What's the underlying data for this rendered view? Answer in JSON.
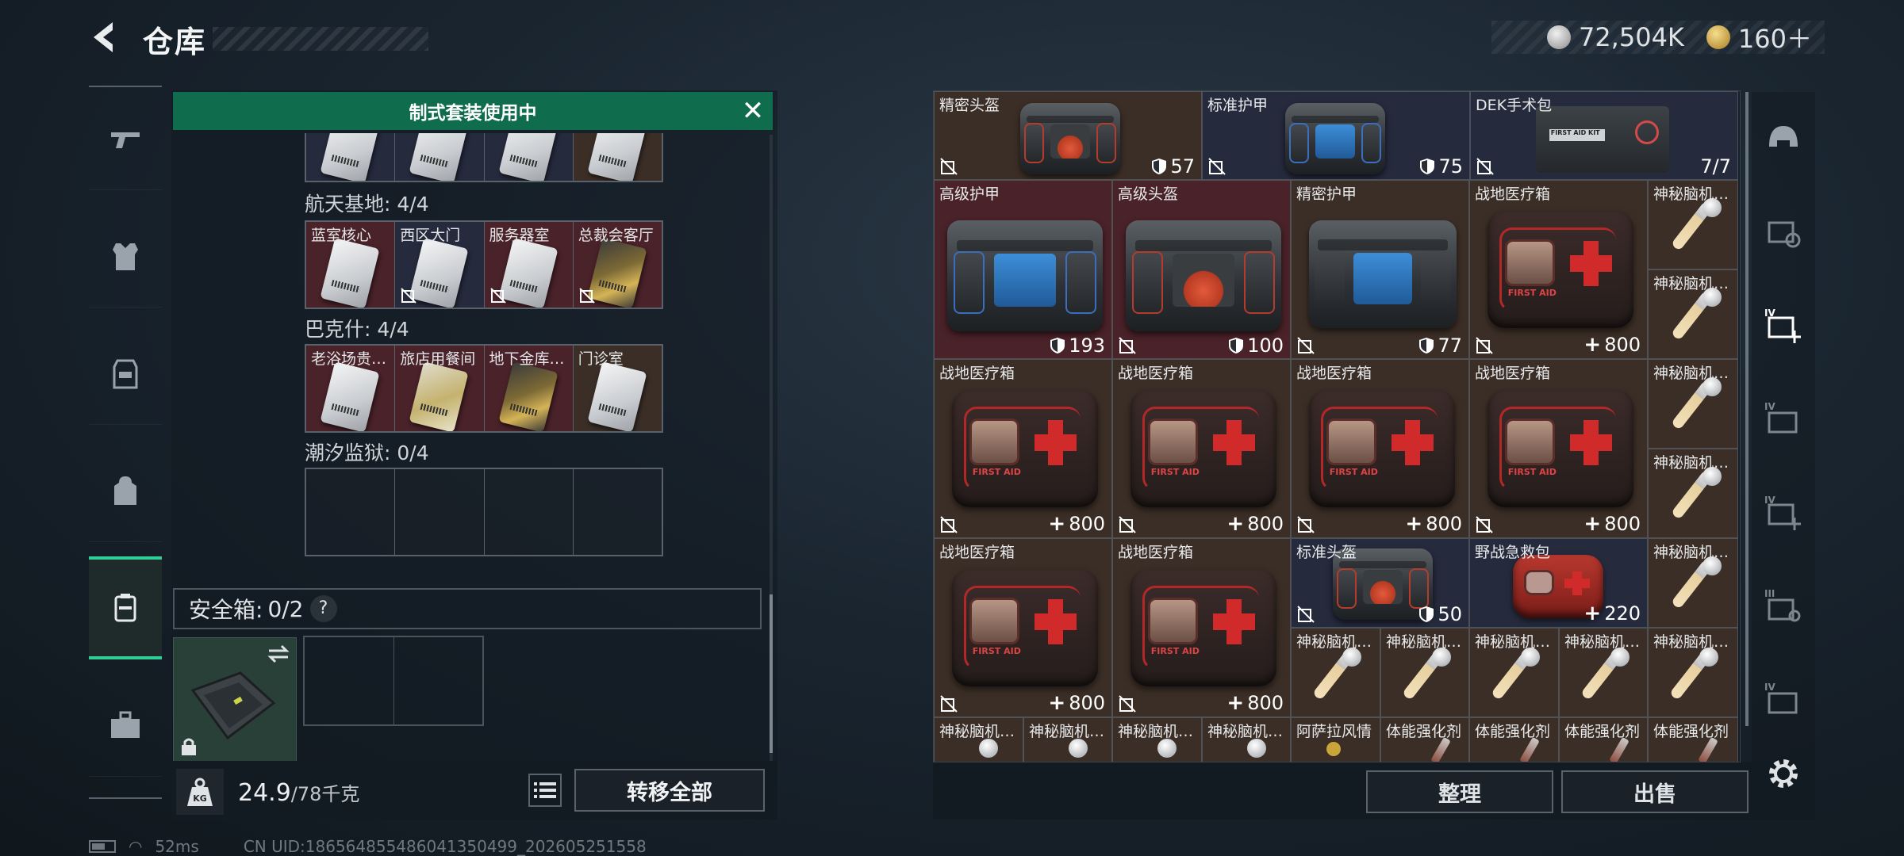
{
  "header": {
    "title": "仓库",
    "silver_amount": "72,504K",
    "gold_amount": "160＋"
  },
  "banner": {
    "text": "制式套装使用中"
  },
  "left": {
    "sections": [
      {
        "label": "航天基地: 4/4",
        "keys": [
          "蓝室核心",
          "西区大门",
          "服务器室",
          "总裁会客厅"
        ]
      },
      {
        "label": "巴克什: 4/4",
        "keys": [
          "老浴场贵…",
          "旅店用餐间",
          "地下金库…",
          "门诊室"
        ]
      },
      {
        "label": "潮汐监狱: 0/4",
        "keys": []
      }
    ],
    "safe_box_label": "安全箱:",
    "safe_box_count": "0/2",
    "help": "?",
    "weight_value": "24.9",
    "weight_max": "/78千克",
    "kg_label": "KG",
    "transfer_all": "转移全部"
  },
  "items": {
    "r1": [
      {
        "name": "精密头盔",
        "value": "57"
      },
      {
        "name": "标准护甲",
        "value": "75"
      },
      {
        "name": "DEK手术包",
        "value": "7/7",
        "kit_label": "FIRST AID KIT"
      }
    ],
    "r2": [
      {
        "name": "高级护甲",
        "value": "193"
      },
      {
        "name": "高级头盔",
        "value": "100"
      },
      {
        "name": "精密护甲",
        "value": "77"
      },
      {
        "name": "战地医疗箱",
        "value": "800"
      }
    ],
    "r3": [
      {
        "name": "战地医疗箱",
        "value": "800"
      },
      {
        "name": "战地医疗箱",
        "value": "800"
      },
      {
        "name": "战地医疗箱",
        "value": "800"
      },
      {
        "name": "战地医疗箱",
        "value": "800"
      }
    ],
    "r4": [
      {
        "name": "战地医疗箱",
        "value": "800"
      },
      {
        "name": "战地医疗箱",
        "value": "800"
      },
      {
        "name": "标准头盔",
        "value": "50"
      },
      {
        "name": "野战急救包",
        "value": "220"
      }
    ],
    "first_aid": "FIRST AID",
    "syringe_name": "神秘脑机…",
    "syringe_name_b": "神秘脑机…",
    "bottom_row": [
      "神秘脑机…",
      "神秘脑机…",
      "神秘脑机…",
      "神秘脑机…",
      "阿萨拉风情",
      "体能强化剂",
      "体能强化剂",
      "体能强化剂",
      "体能强化剂"
    ],
    "syringe_row": [
      "神秘脑机…",
      "神秘脑机…",
      "神秘脑机…",
      "神秘脑机…",
      "神秘脑机…"
    ]
  },
  "right_footer": {
    "sort": "整理",
    "sell": "出售"
  },
  "status": {
    "ping": "52ms",
    "uid": "CN UID:1865648554860413504​99_202605251558"
  },
  "colors": {
    "accent": "#2ed097",
    "banner": "#0f6d4d",
    "cell_red": "#4a2229",
    "cell_navy": "#252a3d",
    "cell_brown": "#3b2e26"
  },
  "icons": {
    "left_nav": [
      "pistol-icon",
      "armor-vest-icon",
      "chest-rig-icon",
      "backpack-icon",
      "keycard-case-icon",
      "toolbox-icon"
    ],
    "right_nav": [
      "helmet-filter-icon",
      "weapon-case-icon",
      "medical-filter-icon",
      "iv-case-icon",
      "iv-medical-icon",
      "iii-case-icon",
      "iv-case-icon-2"
    ]
  }
}
